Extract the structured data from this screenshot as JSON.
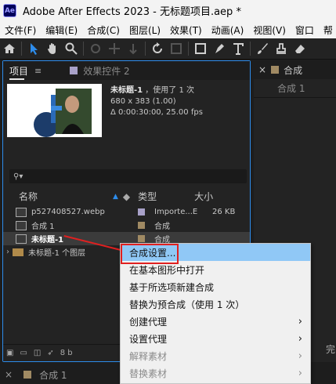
{
  "window": {
    "logo": "Ae",
    "title": "Adobe After Effects 2023 - 无标题项目.aep *"
  },
  "menu": [
    "文件(F)",
    "编辑(E)",
    "合成(C)",
    "图层(L)",
    "效果(T)",
    "动画(A)",
    "视图(V)",
    "窗口",
    "帮"
  ],
  "project_panel": {
    "tab_label": "项目",
    "menu_icon": "≡",
    "effects_tab": "效果控件 2",
    "selected_info": {
      "name": "未标题-1",
      "usage": "，使用了 1 次",
      "dims": "680 x 383 (1.00)",
      "duration": "Δ 0:00:30:00, 25.00 fps"
    },
    "search_icon": "⚲▾",
    "columns": {
      "name": "名称",
      "type": "类型",
      "size": "大小"
    },
    "items": [
      {
        "name": "p527408527.webp",
        "type": "Importe...E",
        "size": "26 KB",
        "label_color": "#a8a1c8",
        "icon": "image-icon"
      },
      {
        "name": "合成 1",
        "type": "合成",
        "size": "",
        "label_color": "#a08a63",
        "icon": "composition-icon"
      },
      {
        "name": "未标题-1",
        "type": "合成",
        "size": "",
        "label_color": "#a08a63",
        "icon": "composition-icon"
      },
      {
        "name": "未标题-1 个图层",
        "type": "",
        "size": "",
        "label_color": "",
        "icon": "folder-icon"
      }
    ],
    "footer_bpc": "8 b"
  },
  "right_panel": {
    "tab": "合成",
    "subtab": "合成 1",
    "footer_text": "完"
  },
  "bottom": {
    "tab": "合成 1"
  },
  "context_menu": {
    "items": [
      {
        "label": "合成设置...",
        "highlighted": true,
        "disabled": false,
        "submenu": false
      },
      {
        "label": "在基本图形中打开",
        "highlighted": false,
        "disabled": false,
        "submenu": false
      },
      {
        "label": "基于所选项新建合成",
        "highlighted": false,
        "disabled": false,
        "submenu": false
      },
      {
        "label": "替换为预合成（使用 1 次）",
        "highlighted": false,
        "disabled": false,
        "submenu": false
      },
      {
        "label": "创建代理",
        "highlighted": false,
        "disabled": false,
        "submenu": true
      },
      {
        "label": "设置代理",
        "highlighted": false,
        "disabled": false,
        "submenu": true
      },
      {
        "label": "解释素材",
        "highlighted": false,
        "disabled": true,
        "submenu": true
      },
      {
        "label": "替换素材",
        "highlighted": false,
        "disabled": true,
        "submenu": true
      }
    ],
    "submenu_arrow": "›"
  },
  "colors": {
    "accent": "#2d8ceb",
    "highlight": "#90c8f6",
    "annotation": "#e02020"
  }
}
